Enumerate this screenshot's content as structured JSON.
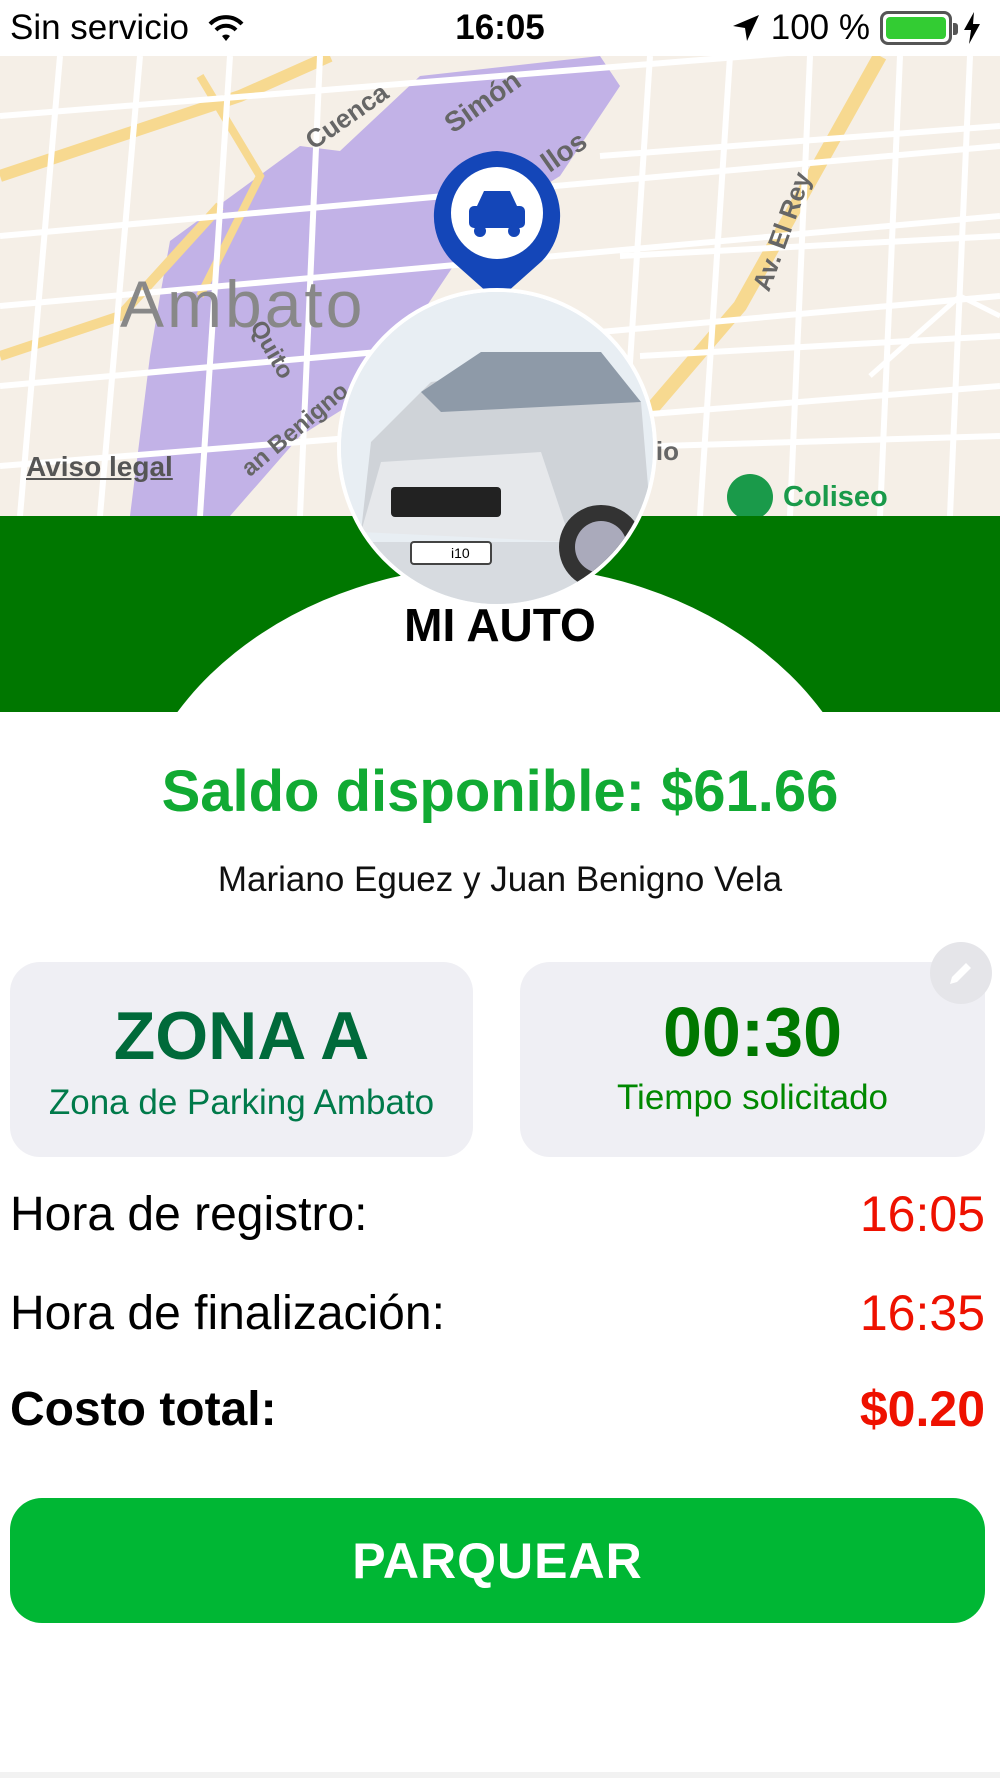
{
  "status_bar": {
    "carrier": "Sin servicio",
    "time": "16:05",
    "battery": "100 %",
    "battery_color": "#33cc33"
  },
  "map": {
    "streets": [
      "Cuenca",
      "Simón",
      "llos",
      "Av. El Rey",
      "Quito",
      "an Benigno",
      "uio"
    ],
    "city": "Ambato",
    "legal_link": "Aviso legal",
    "poi": "Coliseo",
    "zone_color": "#b9a7e6"
  },
  "vehicle": {
    "title": "MI AUTO",
    "image_alt": "Hyundai i10 plateado",
    "plate_text": "i10"
  },
  "balance": {
    "text": "Saldo disponible: $61.66",
    "color": "#11aa33"
  },
  "address": "Mariano Eguez y Juan Benigno Vela",
  "zone_card": {
    "name": "ZONA A",
    "description": "Zona de Parking Ambato"
  },
  "time_card": {
    "value": "00:30",
    "label": "Tiempo solicitado"
  },
  "details": {
    "start_label": "Hora de registro:",
    "start_value": "16:05",
    "end_label": "Hora de finalización:",
    "end_value": "16:35",
    "cost_label": "Costo total:",
    "cost_value": "$0.20",
    "value_color": "#ee1100"
  },
  "actions": {
    "park_label": "PARQUEAR"
  },
  "colors": {
    "brand_green": "#007700",
    "button_green": "#00b734"
  }
}
